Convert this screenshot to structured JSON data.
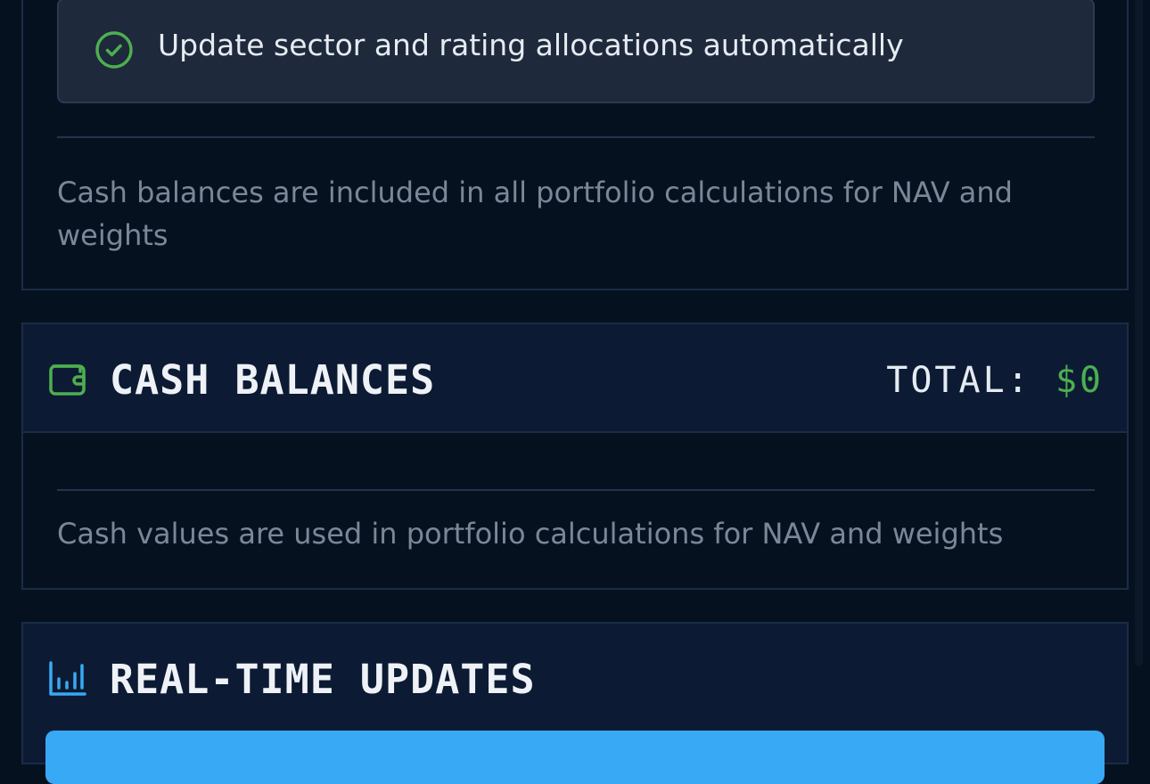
{
  "settings_card": {
    "auto_update_text": "Update sector and rating allocations automatically",
    "note": "Cash balances are included in all portfolio calculations for NAV and weights"
  },
  "cash_card": {
    "title": "CASH BALANCES",
    "total_label": "TOTAL:",
    "total_value": "$0",
    "note": "Cash values are used in portfolio calculations for NAV and weights",
    "icon": "wallet-icon"
  },
  "realtime_card": {
    "title": "REAL-TIME UPDATES",
    "icon": "bar-chart-icon"
  },
  "colors": {
    "accent_green": "#4caf50",
    "accent_blue": "#38a9f4",
    "background": "#061120",
    "card_header": "#0c1b33"
  }
}
